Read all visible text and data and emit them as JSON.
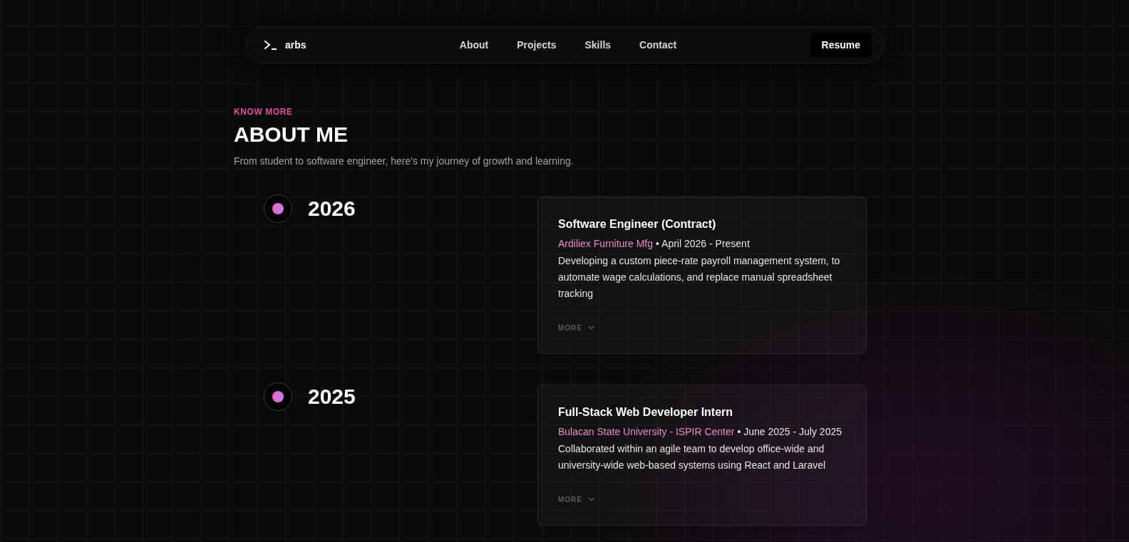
{
  "nav": {
    "logo": "arbs",
    "links": [
      {
        "label": "About"
      },
      {
        "label": "Projects"
      },
      {
        "label": "Skills"
      },
      {
        "label": "Contact"
      }
    ],
    "resume": "Resume"
  },
  "header": {
    "eyebrow": "KNOW MORE",
    "title": "ABOUT ME",
    "subtitle": "From student to software engineer, here's my journey of growth and learning."
  },
  "timeline": [
    {
      "year": "2026",
      "role": "Software Engineer (Contract)",
      "company": "Ardiliex Furniture Mfg",
      "period": "• April 2026 - Present",
      "description": "Developing a custom piece-rate payroll management system, to automate wage calculations, and replace manual spreadsheet tracking",
      "more": "MORE",
      "expanded": false
    },
    {
      "year": "2025",
      "role": "Full-Stack Web Developer Intern",
      "company": "Bulacan State University - ISPIR Center",
      "period": "• June 2025 - July 2025",
      "description": "Collaborated within an agile team to develop office-wide and university-wide web-based systems using React and Laravel",
      "more": "MORE",
      "expanded": false
    }
  ]
}
